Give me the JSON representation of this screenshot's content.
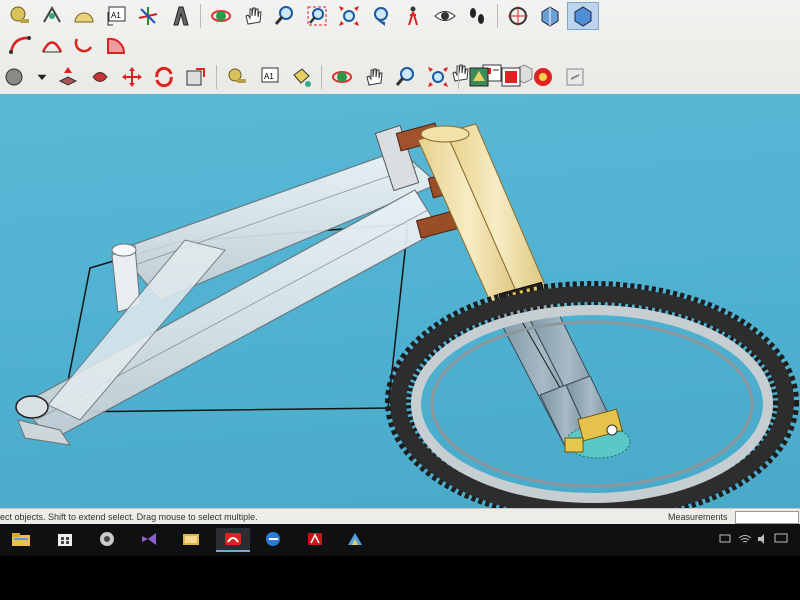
{
  "toolbar": {
    "row1_label_tool": "A1",
    "row3_label_tool": "A1"
  },
  "statusbar": {
    "text": "ect objects. Shift to extend select. Drag mouse to select multiple.",
    "measurements_label": "Measurements",
    "measurements_value": ""
  },
  "colors": {
    "viewport_sky": "#55b4d4",
    "frame_tube": "#dfe6ea",
    "fork_stanchion": "#f2e2a8",
    "fork_lower": "#8ea4b2",
    "tire": "#1e1e1e",
    "rotor": "#5bc7c7"
  },
  "taskbar": {
    "apps": [
      "file-explorer",
      "store",
      "steam",
      "visual-studio",
      "photos",
      "sketchup",
      "edge",
      "acrobat",
      "layout"
    ]
  }
}
